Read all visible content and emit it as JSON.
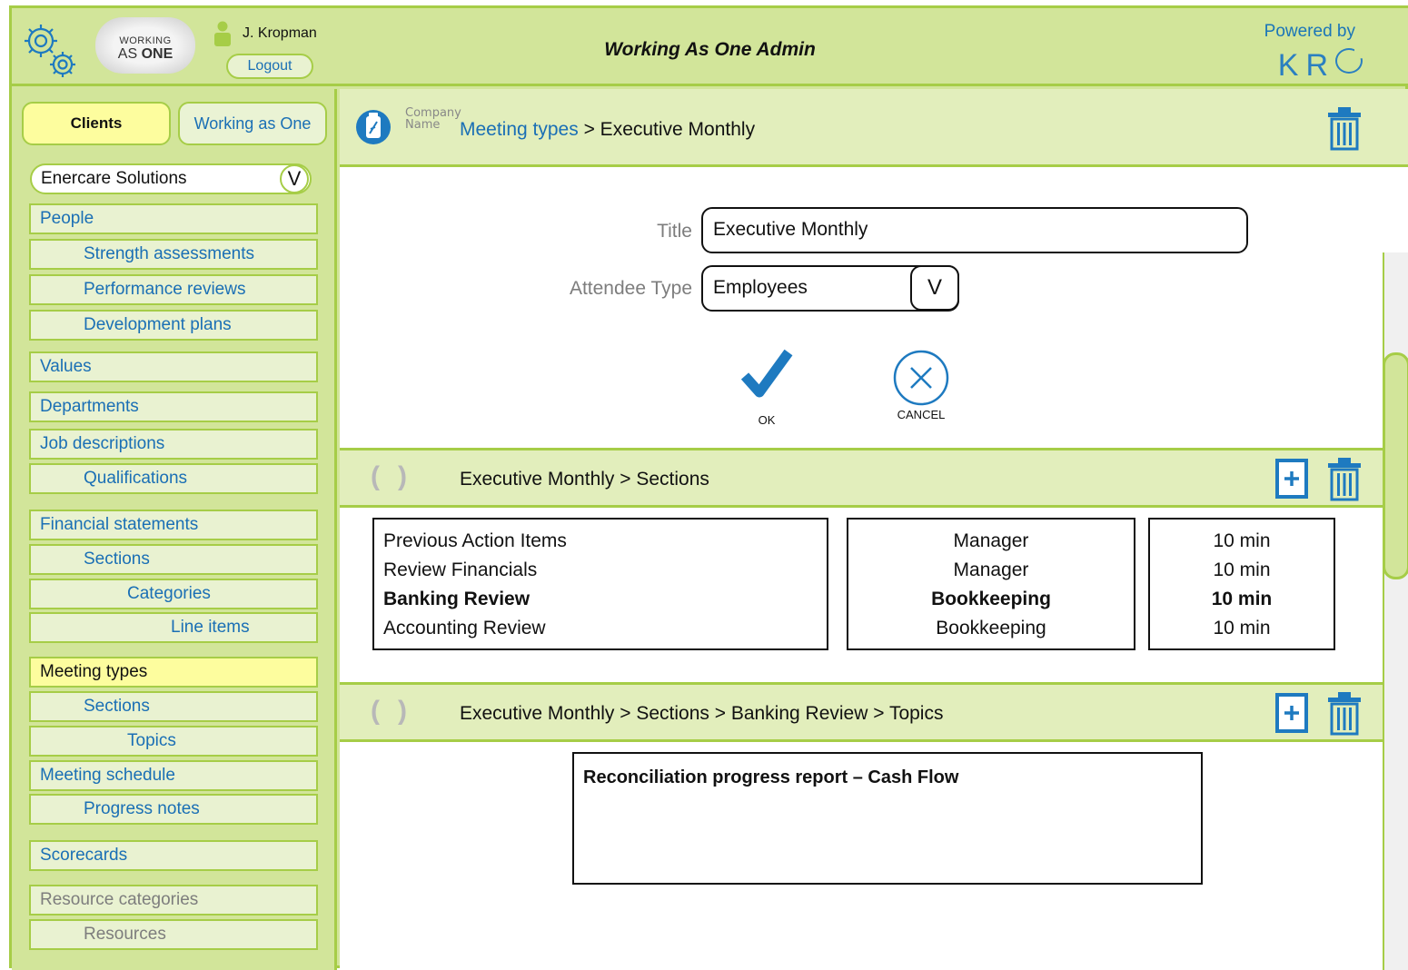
{
  "header": {
    "user_name": "J. Kropman",
    "logout_label": "Logout",
    "app_title": "Working As One Admin",
    "powered_by": "Powered by",
    "brand": "KR",
    "logo_line1": "WORKING",
    "logo_line2a": "AS ",
    "logo_line2b": "ONE"
  },
  "sidebar": {
    "tab_clients": "Clients",
    "tab_wao": "Working as One",
    "client_selected": "Enercare Solutions",
    "client_dropdown_glyph": "V",
    "items": [
      {
        "label": "People"
      },
      {
        "label": "Strength assessments"
      },
      {
        "label": "Performance reviews"
      },
      {
        "label": "Development plans"
      },
      {
        "label": "Values"
      },
      {
        "label": "Departments"
      },
      {
        "label": "Job descriptions"
      },
      {
        "label": "Qualifications"
      },
      {
        "label": "Financial statements"
      },
      {
        "label": "Sections"
      },
      {
        "label": "Categories"
      },
      {
        "label": "Line items"
      },
      {
        "label": "Meeting types"
      },
      {
        "label": "Sections"
      },
      {
        "label": "Topics"
      },
      {
        "label": "Meeting schedule"
      },
      {
        "label": "Progress notes"
      },
      {
        "label": "Scorecards"
      },
      {
        "label": "Resource categories"
      },
      {
        "label": "Resources"
      }
    ]
  },
  "main": {
    "company_name_line1": "Company",
    "company_name_line2": "Name",
    "breadcrumb_link": "Meeting types",
    "breadcrumb_rest": " > Executive Monthly",
    "form": {
      "title_label": "Title",
      "title_value": "Executive Monthly",
      "attendee_label": "Attendee Type",
      "attendee_value": "Employees",
      "dropdown_glyph": "V",
      "ok_label": "OK",
      "cancel_label": "CANCEL"
    },
    "sections_bar_title": "Executive Monthly > Sections",
    "sections": {
      "names": [
        "Previous Action Items",
        "Review Financials",
        "Banking Review",
        "Accounting Review"
      ],
      "roles": [
        "Manager",
        "Manager",
        "Bookkeeping",
        "Bookkeeping"
      ],
      "durations": [
        "10 min",
        "10 min",
        "10 min",
        "10 min"
      ],
      "selected_index": 2
    },
    "topics_bar_title": "Executive Monthly > Sections > Banking Review > Topics",
    "topics": [
      "Reconciliation progress report – Cash Flow"
    ]
  },
  "colors": {
    "accent_green": "#a6cd47",
    "panel_green": "#d2e59a",
    "active_yellow": "#fdfd9e",
    "link_blue": "#1a6fb5",
    "icon_blue": "#1e7ac0"
  }
}
